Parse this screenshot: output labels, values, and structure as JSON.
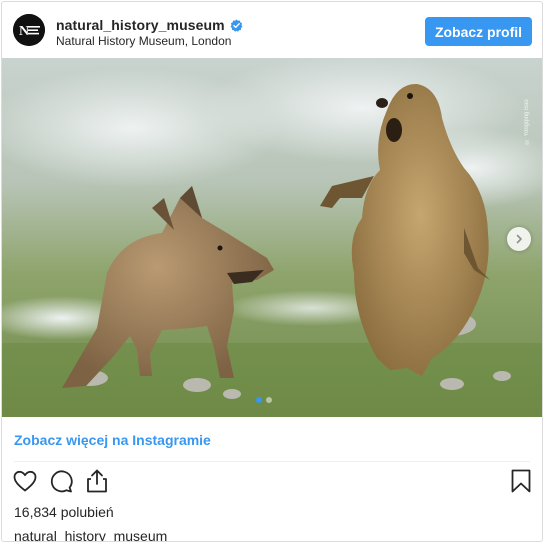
{
  "header": {
    "avatar_icon": "nhm-logo-icon",
    "username": "natural_history_museum",
    "verified_icon": "verified-badge-icon",
    "location": "Natural History Museum, London",
    "profile_button": "Zobacz profil"
  },
  "media": {
    "photo_credit": "© Yongqing Bao",
    "next_icon": "chevron-right-icon",
    "carousel": {
      "total": 2,
      "active_index": 0
    }
  },
  "view_more_link": "Zobacz więcej na Instagramie",
  "actions": {
    "like_icon": "heart-icon",
    "comment_icon": "comment-icon",
    "share_icon": "share-icon",
    "save_icon": "bookmark-icon"
  },
  "likes_text": "16,834 polubień",
  "caption_username": "natural_history_museum",
  "colors": {
    "accent": "#3897f0",
    "text": "#262626",
    "border": "#dbdbdb"
  }
}
